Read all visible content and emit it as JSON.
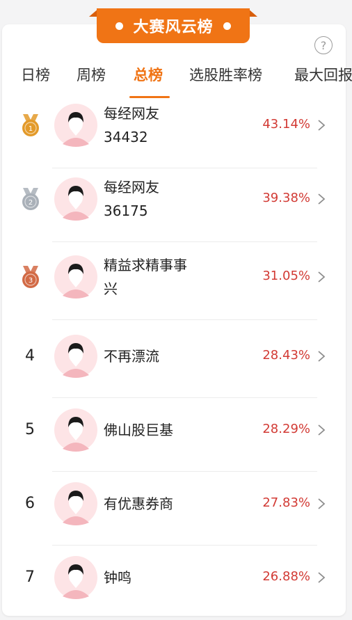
{
  "banner": {
    "title": "大赛风云榜"
  },
  "help": {
    "symbol": "?"
  },
  "tabs": [
    {
      "label": "日榜",
      "active": false
    },
    {
      "label": "周榜",
      "active": false
    },
    {
      "label": "总榜",
      "active": true
    },
    {
      "label": "选股胜率榜",
      "active": false
    },
    {
      "label": "最大回报",
      "active": false
    }
  ],
  "ranking": [
    {
      "rank": "1",
      "medal": "gold-medal",
      "name_line1": "每经网友",
      "name_line2": "34432",
      "percent": "43.14%"
    },
    {
      "rank": "2",
      "medal": "silver-medal",
      "name_line1": "每经网友",
      "name_line2": "36175",
      "percent": "39.38%"
    },
    {
      "rank": "3",
      "medal": "bronze-medal",
      "name_line1": "精益求精事事",
      "name_line2": "兴",
      "percent": "31.05%"
    },
    {
      "rank": "4",
      "name_line1": "不再漂流",
      "name_line2": "",
      "percent": "28.43%"
    },
    {
      "rank": "5",
      "name_line1": "佛山股巨基",
      "name_line2": "",
      "percent": "28.29%"
    },
    {
      "rank": "6",
      "name_line1": "有优惠券商",
      "name_line2": "",
      "percent": "27.83%"
    },
    {
      "rank": "7",
      "name_line1": "钟鸣",
      "name_line2": "",
      "percent": "26.88%"
    }
  ],
  "colors": {
    "accent": "#f07415",
    "percent": "#d23a34",
    "gold": "#e39a2a",
    "silver": "#a9b0b8",
    "bronze": "#d26a45",
    "avatar_bg": "#fde4e6"
  }
}
